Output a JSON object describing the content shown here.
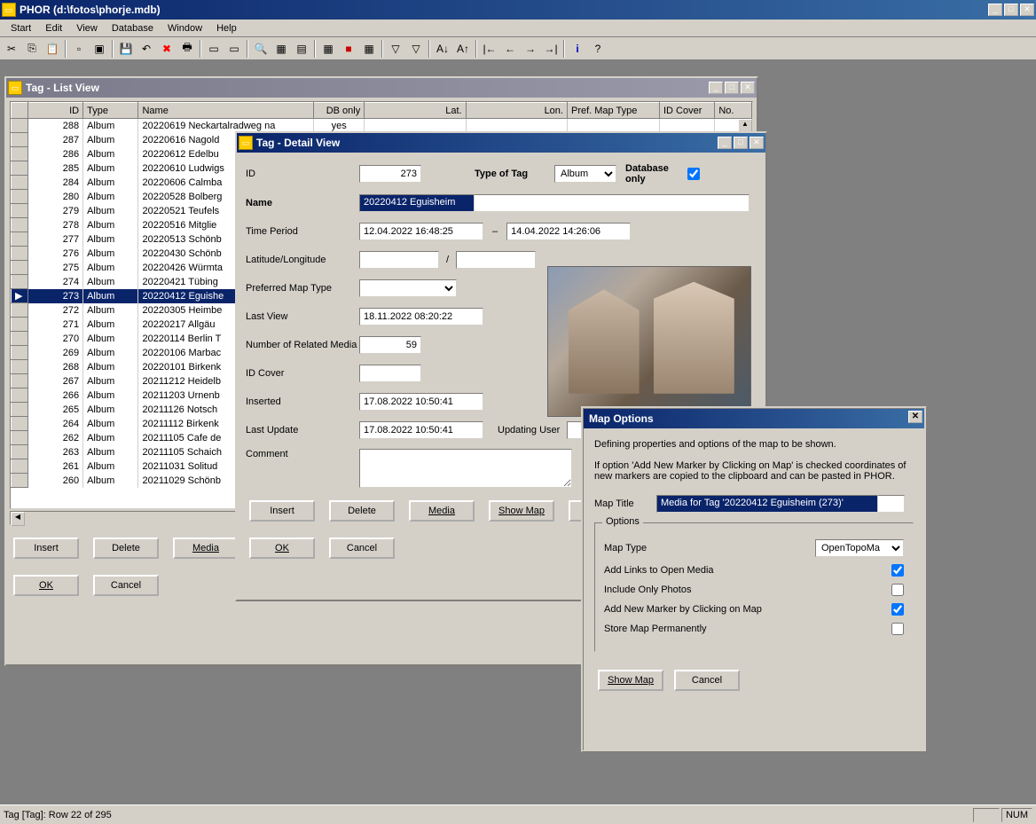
{
  "app": {
    "title": "PHOR (d:\\fotos\\phorje.mdb)",
    "status": "Tag [Tag]: Row 22 of 295",
    "status_num": "NUM"
  },
  "menu": [
    "Start",
    "Edit",
    "View",
    "Database",
    "Window",
    "Help"
  ],
  "listview": {
    "title": "Tag - List View",
    "columns": [
      "",
      "ID",
      "Type",
      "Name",
      "DB only",
      "Lat.",
      "Lon.",
      "Pref. Map Type",
      "ID Cover",
      "No."
    ],
    "rows": [
      {
        "id": "288",
        "type": "Album",
        "name": "20220619 Neckartalradweg na",
        "db": "yes"
      },
      {
        "id": "287",
        "type": "Album",
        "name": "20220616 Nagold",
        "db": ""
      },
      {
        "id": "286",
        "type": "Album",
        "name": "20220612 Edelbu",
        "db": ""
      },
      {
        "id": "285",
        "type": "Album",
        "name": "20220610 Ludwigs",
        "db": ""
      },
      {
        "id": "284",
        "type": "Album",
        "name": "20220606 Calmba",
        "db": ""
      },
      {
        "id": "280",
        "type": "Album",
        "name": "20220528 Bolberg",
        "db": ""
      },
      {
        "id": "279",
        "type": "Album",
        "name": "20220521 Teufels",
        "db": ""
      },
      {
        "id": "278",
        "type": "Album",
        "name": "20220516 Mitglie",
        "db": ""
      },
      {
        "id": "277",
        "type": "Album",
        "name": "20220513 Schönb",
        "db": ""
      },
      {
        "id": "276",
        "type": "Album",
        "name": "20220430 Schönb",
        "db": ""
      },
      {
        "id": "275",
        "type": "Album",
        "name": "20220426 Würmta",
        "db": ""
      },
      {
        "id": "274",
        "type": "Album",
        "name": "20220421 Tübing",
        "db": ""
      },
      {
        "id": "273",
        "type": "Album",
        "name": "20220412 Eguishe",
        "db": "",
        "sel": true
      },
      {
        "id": "272",
        "type": "Album",
        "name": "20220305 Heimbe",
        "db": ""
      },
      {
        "id": "271",
        "type": "Album",
        "name": "20220217 Allgäu",
        "db": ""
      },
      {
        "id": "270",
        "type": "Album",
        "name": "20220114 Berlin T",
        "db": ""
      },
      {
        "id": "269",
        "type": "Album",
        "name": "20220106 Marbac",
        "db": ""
      },
      {
        "id": "268",
        "type": "Album",
        "name": "20220101 Birkenk",
        "db": ""
      },
      {
        "id": "267",
        "type": "Album",
        "name": "20211212 Heidelb",
        "db": ""
      },
      {
        "id": "266",
        "type": "Album",
        "name": "20211203 Urnenb",
        "db": ""
      },
      {
        "id": "265",
        "type": "Album",
        "name": "20211126 Notsch",
        "db": ""
      },
      {
        "id": "264",
        "type": "Album",
        "name": "20211112 Birkenk",
        "db": ""
      },
      {
        "id": "262",
        "type": "Album",
        "name": "20211105 Cafe de",
        "db": ""
      },
      {
        "id": "263",
        "type": "Album",
        "name": "20211105 Schaich",
        "db": ""
      },
      {
        "id": "261",
        "type": "Album",
        "name": "20211031 Solitud",
        "db": ""
      },
      {
        "id": "260",
        "type": "Album",
        "name": "20211029 Schönb",
        "db": ""
      }
    ],
    "buttons": {
      "insert": "Insert",
      "delete": "Delete",
      "media": "Media",
      "ok": "OK",
      "cancel": "Cancel"
    }
  },
  "detail": {
    "title": "Tag - Detail View",
    "labels": {
      "id": "ID",
      "type": "Type of Tag",
      "dbonly": "Database only",
      "name": "Name",
      "period": "Time Period",
      "latlon": "Latitude/Longitude",
      "maptype": "Preferred Map Type",
      "lastview": "Last View",
      "nummedia": "Number of Related Media",
      "idcover": "ID Cover",
      "inserted": "Inserted",
      "lastupdate": "Last Update",
      "updatinguser": "Updating User",
      "comment": "Comment"
    },
    "values": {
      "id": "273",
      "type": "Album",
      "dbonly": true,
      "name": "20220412 Eguisheim",
      "period_from": "12.04.2022 16:48:25",
      "period_to": "14.04.2022 14:26:06",
      "lat": "",
      "lon": "",
      "maptype": "",
      "lastview": "18.11.2022 08:20:22",
      "nummedia": "59",
      "idcover": "",
      "inserted": "17.08.2022 10:50:41",
      "lastupdate": "17.08.2022 10:50:41",
      "updatinguser": "",
      "comment": ""
    },
    "buttons": {
      "insert": "Insert",
      "delete": "Delete",
      "media": "Media",
      "showmap": "Show Map",
      "ok": "OK",
      "cancel": "Cancel"
    }
  },
  "mapopt": {
    "title": "Map Options",
    "desc1": "Defining properties and options of the map to be shown.",
    "desc2": "If option 'Add New Marker by Clicking on Map' is checked coordinates of new markers are copied to the clipboard and can be pasted in PHOR.",
    "maptitle_label": "Map Title",
    "maptitle": "Media for Tag '20220412 Eguisheim (273)'",
    "options_legend": "Options",
    "labels": {
      "maptype": "Map Type",
      "addlinks": "Add Links to Open Media",
      "onlyphotos": "Include Only Photos",
      "addmarker": "Add New Marker by Clicking on Map",
      "store": "Store Map Permanently"
    },
    "values": {
      "maptype": "OpenTopoMa",
      "addlinks": true,
      "onlyphotos": false,
      "addmarker": true,
      "store": false
    },
    "buttons": {
      "showmap": "Show Map",
      "cancel": "Cancel"
    }
  }
}
